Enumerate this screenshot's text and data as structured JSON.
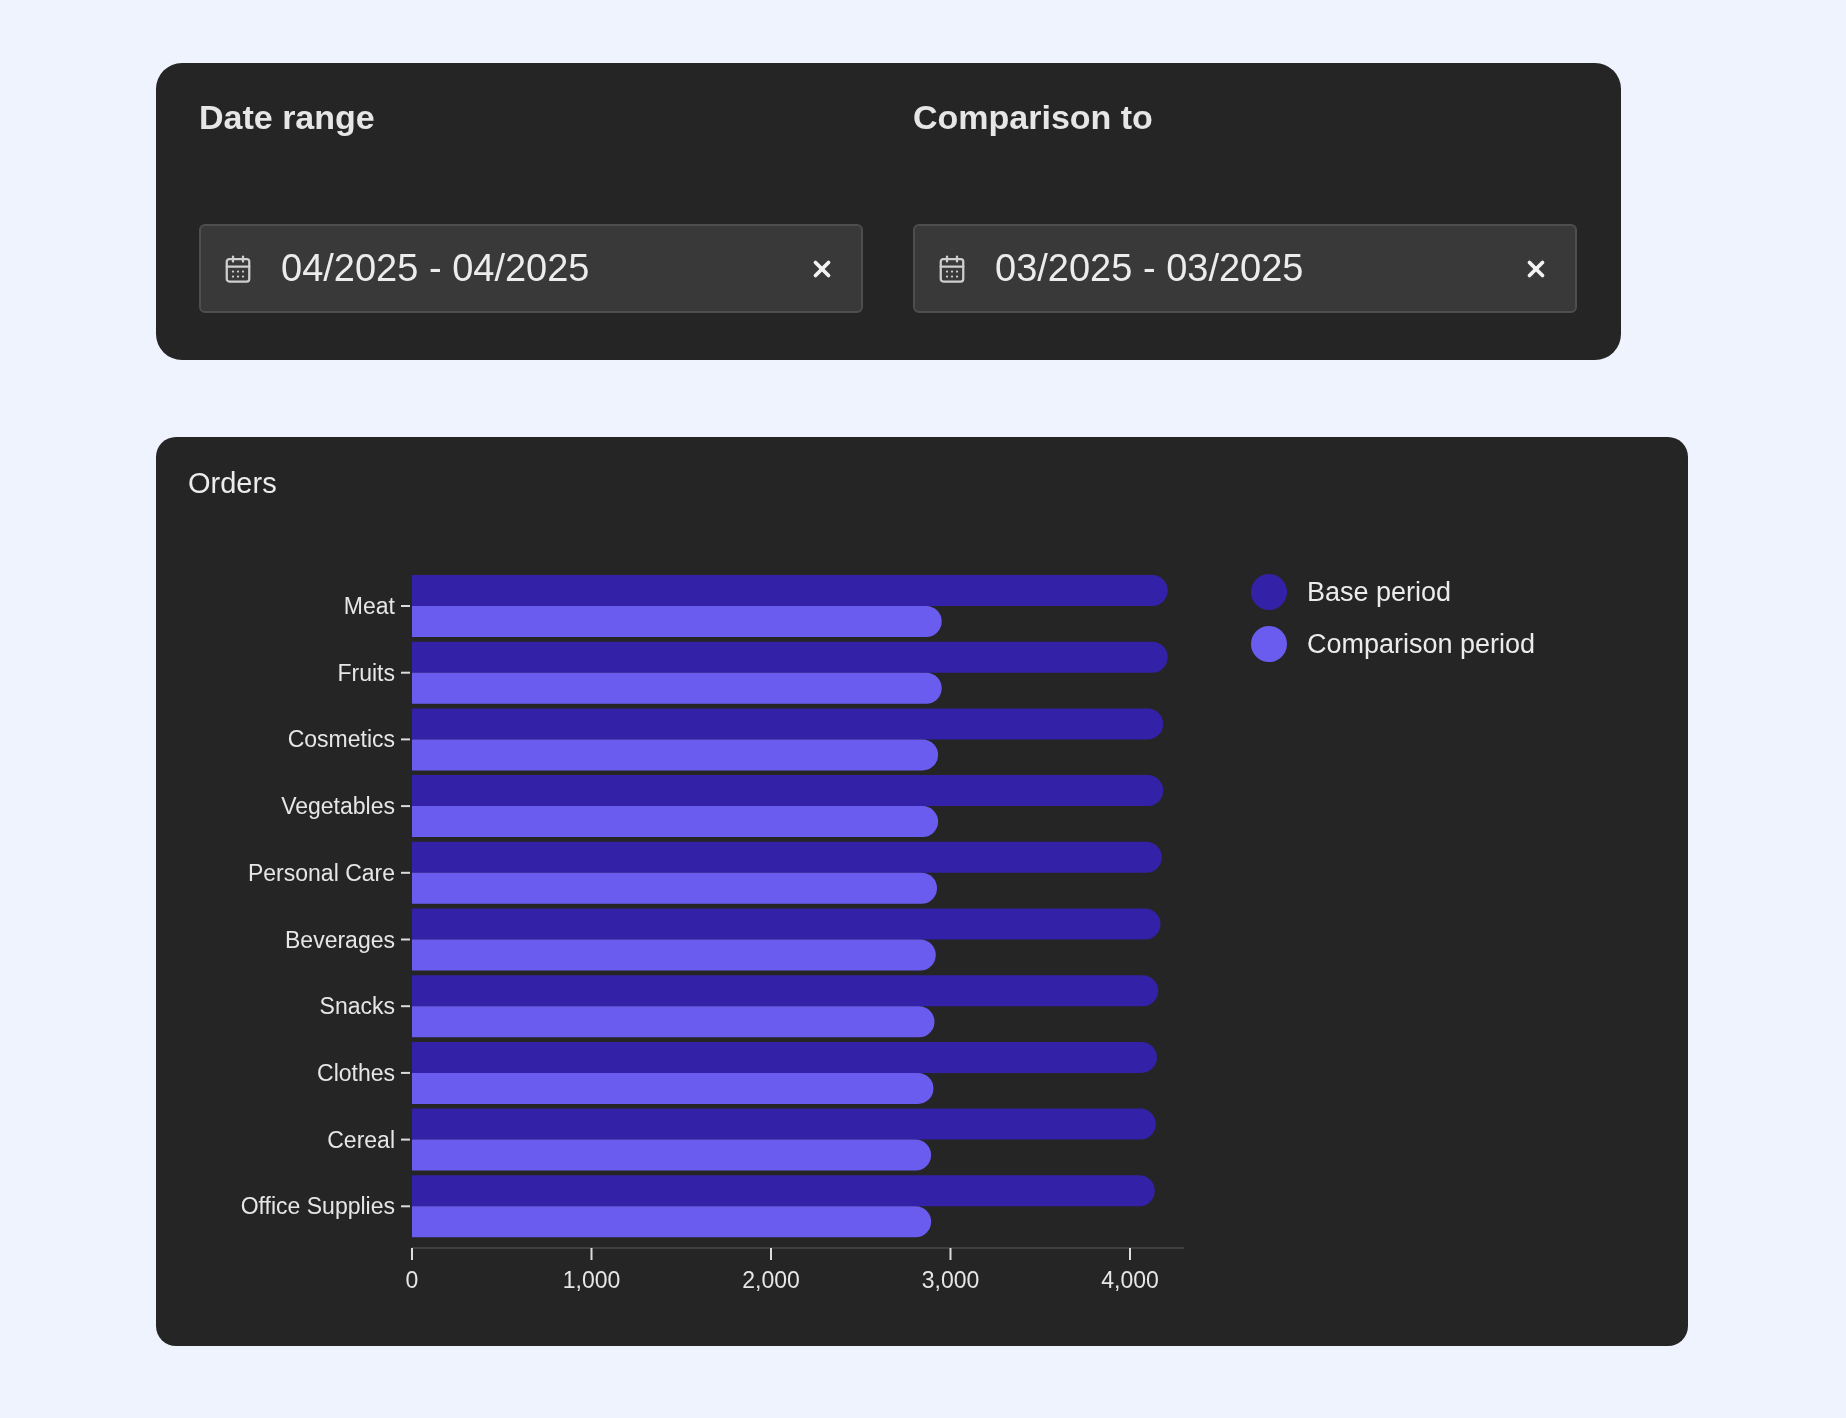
{
  "filters": [
    {
      "label": "Date range",
      "value": "04/2025 - 04/2025"
    },
    {
      "label": "Comparison to",
      "value": "03/2025 - 03/2025"
    }
  ],
  "orders_card": {
    "chart_data": {
      "type": "bar",
      "orientation": "horizontal",
      "title": "Orders",
      "categories": [
        "Meat",
        "Fruits",
        "Cosmetics",
        "Vegetables",
        "Personal Care",
        "Beverages",
        "Snacks",
        "Clothes",
        "Cereal",
        "Office Supplies"
      ],
      "series": [
        {
          "name": "Base period",
          "color": "#3322a8",
          "values": [
            4210,
            4210,
            4185,
            4185,
            4177,
            4170,
            4157,
            4150,
            4144,
            4138
          ]
        },
        {
          "name": "Comparison period",
          "color": "#6b5cf0",
          "values": [
            2951,
            2951,
            2931,
            2931,
            2925,
            2918,
            2911,
            2905,
            2892,
            2892
          ]
        }
      ],
      "xlim": [
        0,
        4300
      ],
      "xticks": [
        0,
        {
          "value": 1000,
          "label": "1,000"
        },
        {
          "value": 2000,
          "label": "2,000"
        },
        {
          "value": 3000,
          "label": "3,000"
        },
        {
          "value": 4000,
          "label": "4,000"
        }
      ]
    }
  }
}
